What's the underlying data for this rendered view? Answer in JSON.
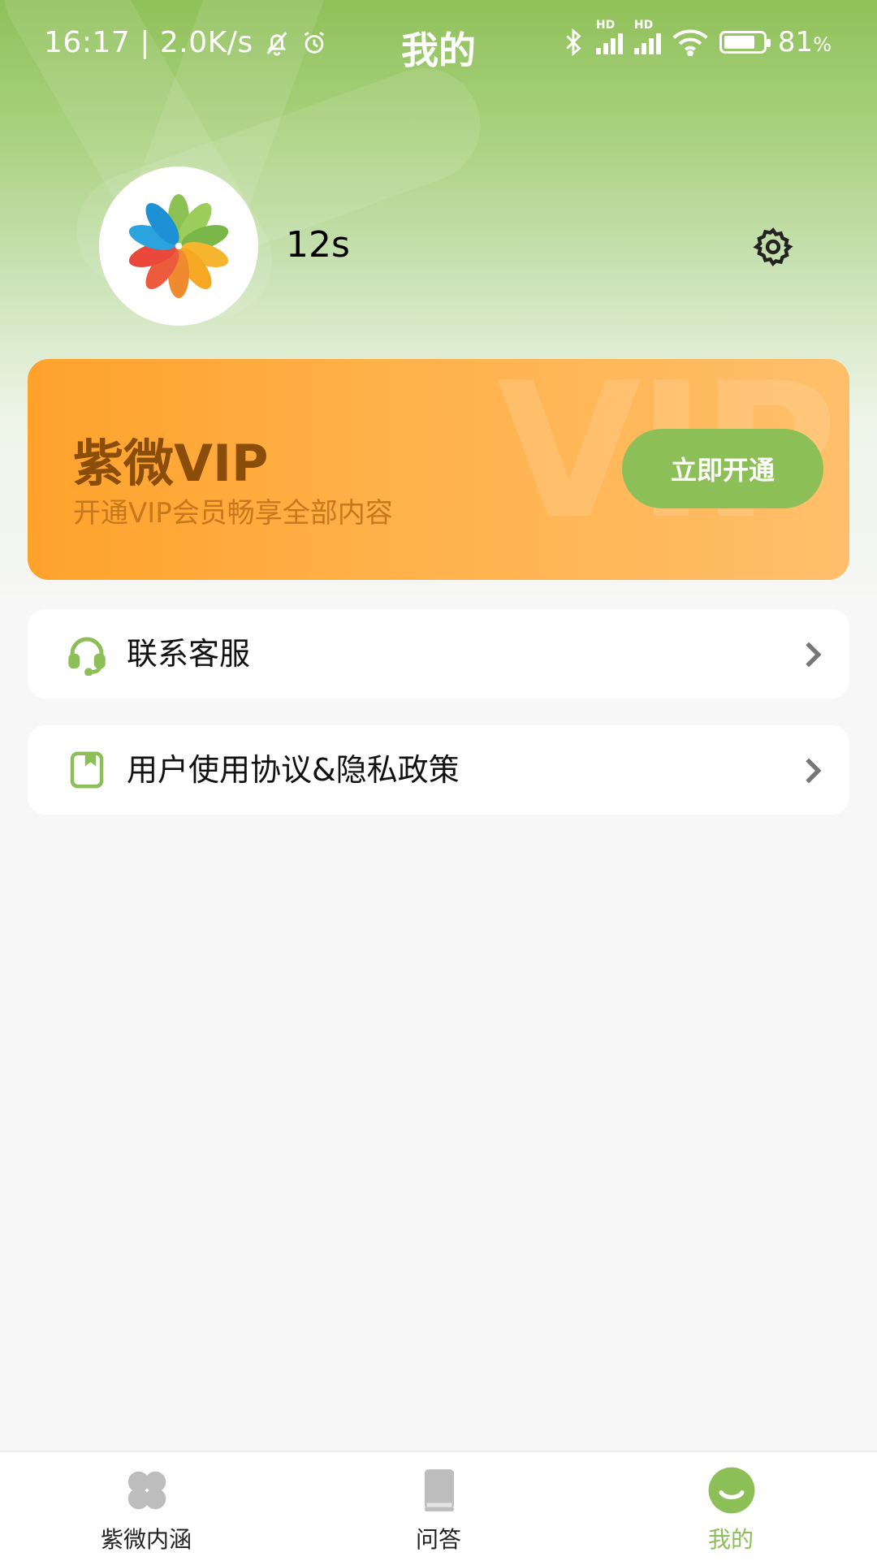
{
  "status_bar": {
    "time": "16:17",
    "net_speed": "2.0K/s",
    "battery": "81",
    "battery_unit": "%",
    "battery_level": 0.81,
    "signal_label_1": "HD",
    "signal_label_2": "HD"
  },
  "header": {
    "title": "我的"
  },
  "profile": {
    "username": "12s"
  },
  "vip": {
    "title": "紫微VIP",
    "subtitle": "开通VIP会员畅享全部内容",
    "button_label": "立即开通",
    "watermark": "VIP"
  },
  "menu": [
    {
      "label": "联系客服",
      "icon": "headset-icon"
    },
    {
      "label": "用户使用协议&隐私政策",
      "icon": "document-icon"
    }
  ],
  "tabs": [
    {
      "label": "紫微内涵",
      "icon": "clover-icon",
      "active": false
    },
    {
      "label": "问答",
      "icon": "book-icon",
      "active": false
    },
    {
      "label": "我的",
      "icon": "smile-icon",
      "active": true
    }
  ],
  "colors": {
    "accent": "#8dbf58",
    "vip_orange": "#ffa22c",
    "vip_title": "#8a4d0a",
    "vip_subtitle": "#c7771c"
  }
}
